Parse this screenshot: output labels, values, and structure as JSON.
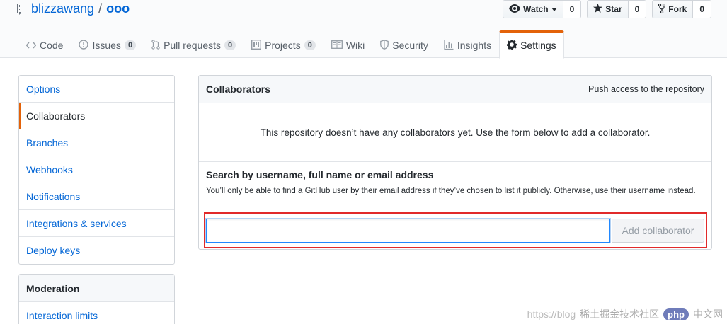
{
  "repo": {
    "owner": "blizzawang",
    "separator": "/",
    "name": "ooo"
  },
  "actions": {
    "watch": {
      "label": "Watch",
      "count": "0"
    },
    "star": {
      "label": "Star",
      "count": "0"
    },
    "fork": {
      "label": "Fork",
      "count": "0"
    }
  },
  "tabs": [
    {
      "label": "Code",
      "icon": "code-icon"
    },
    {
      "label": "Issues",
      "count": "0",
      "icon": "issue-icon"
    },
    {
      "label": "Pull requests",
      "count": "0",
      "icon": "pull-request-icon"
    },
    {
      "label": "Projects",
      "count": "0",
      "icon": "project-icon"
    },
    {
      "label": "Wiki",
      "icon": "book-icon"
    },
    {
      "label": "Security",
      "icon": "shield-icon"
    },
    {
      "label": "Insights",
      "icon": "graph-icon"
    },
    {
      "label": "Settings",
      "icon": "gear-icon",
      "selected": true
    }
  ],
  "sidebar": {
    "items": [
      {
        "label": "Options"
      },
      {
        "label": "Collaborators",
        "selected": true
      },
      {
        "label": "Branches"
      },
      {
        "label": "Webhooks"
      },
      {
        "label": "Notifications"
      },
      {
        "label": "Integrations & services"
      },
      {
        "label": "Deploy keys"
      }
    ],
    "moderation_heading": "Moderation",
    "moderation_items": [
      {
        "label": "Interaction limits"
      }
    ]
  },
  "collaborators": {
    "title": "Collaborators",
    "meta": "Push access to the repository",
    "blank_text": "This repository doesn’t have any collaborators yet. Use the form below to add a collaborator.",
    "search_label": "Search by username, full name or email address",
    "search_note": "You’ll only be able to find a GitHub user by their email address if they’ve chosen to list it publicly. Otherwise, use their username instead.",
    "input_value": "",
    "add_button": "Add collaborator"
  },
  "watermark": {
    "url": "https://blog",
    "badge": "php",
    "text": "中文网",
    "overlay": "稀土掘金技术社区"
  },
  "colors": {
    "accent": "#e36209",
    "link": "#0366d6",
    "highlight": "#e12a2a"
  }
}
